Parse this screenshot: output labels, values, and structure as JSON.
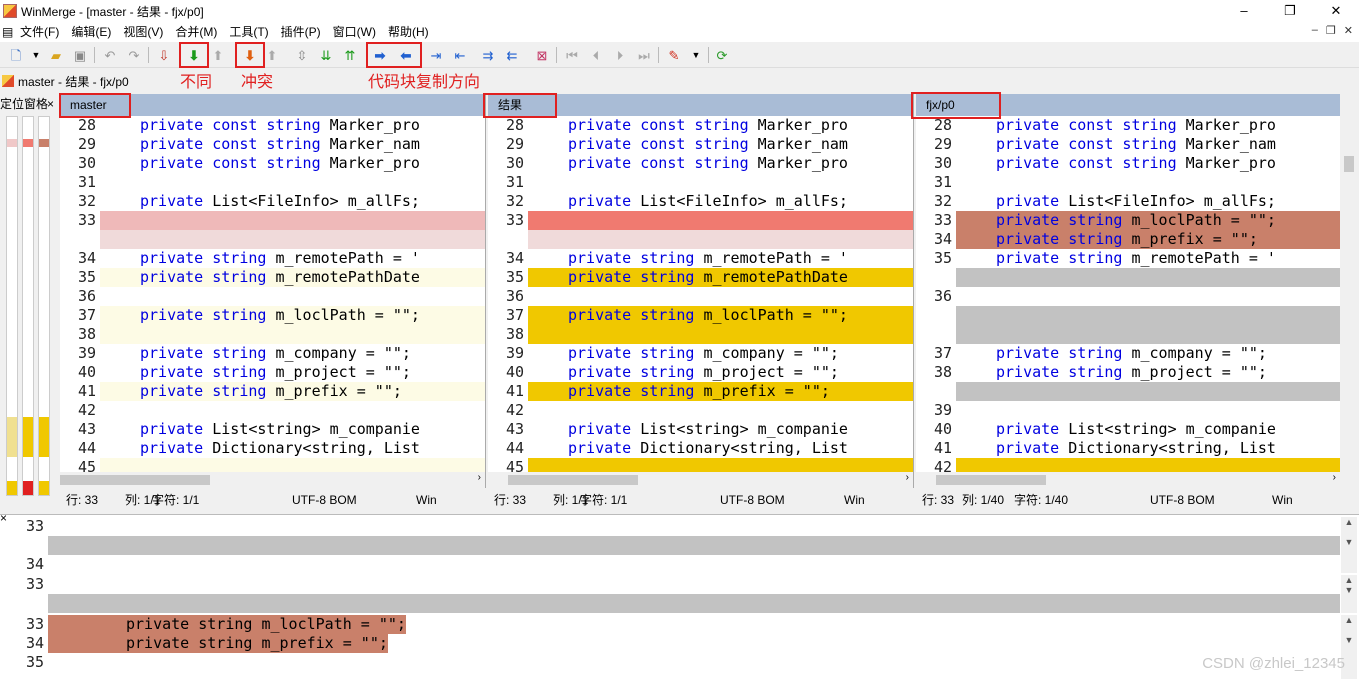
{
  "window": {
    "title": "WinMerge - [master - 结果 - fjx/p0]",
    "controls": [
      "–",
      "❐",
      "✕"
    ]
  },
  "menu": {
    "items": [
      "文件(F)",
      "编辑(E)",
      "视图(V)",
      "合并(M)",
      "工具(T)",
      "插件(P)",
      "窗口(W)",
      "帮助(H)"
    ],
    "mdi_controls": [
      "–",
      "❐",
      "✕"
    ]
  },
  "annotations": {
    "diff": "不同",
    "conflict": "冲突",
    "direction": "代码块复制方向"
  },
  "tab": {
    "label": "master - 结果 - fjx/p0"
  },
  "location_pane": {
    "title": "定位窗格",
    "close": "×"
  },
  "panes": [
    {
      "header": "master",
      "lines": [
        {
          "n": "28",
          "kw": "private const string",
          "rest": " Marker_pro",
          "bg": ""
        },
        {
          "n": "29",
          "kw": "private const string",
          "rest": " Marker_nam",
          "bg": ""
        },
        {
          "n": "30",
          "kw": "private const string",
          "rest": " Marker_pro",
          "bg": ""
        },
        {
          "n": "31",
          "kw": "",
          "rest": "",
          "bg": ""
        },
        {
          "n": "32",
          "kw": "private",
          "rest": " List<FileInfo> m_allFs;",
          "bg": ""
        },
        {
          "n": "33",
          "kw": "",
          "rest": "",
          "bg": "diff-del"
        },
        {
          "n": "",
          "kw": "",
          "rest": "",
          "bg": "diff-del2"
        },
        {
          "n": "34",
          "kw": "private string",
          "rest": " m_remotePath = '",
          "bg": ""
        },
        {
          "n": "35",
          "kw": "private string",
          "rest": " m_remotePathDate",
          "bg": "diff-chg"
        },
        {
          "n": "36",
          "kw": "",
          "rest": "",
          "bg": ""
        },
        {
          "n": "37",
          "kw": "private string",
          "rest": " m_loclPath = \"\";",
          "bg": "diff-chg"
        },
        {
          "n": "38",
          "kw": "",
          "rest": "",
          "bg": "diff-chg"
        },
        {
          "n": "39",
          "kw": "private string",
          "rest": " m_company = \"\";",
          "bg": ""
        },
        {
          "n": "40",
          "kw": "private string",
          "rest": " m_project = \"\";",
          "bg": ""
        },
        {
          "n": "41",
          "kw": "private string",
          "rest": " m_prefix = \"\";",
          "bg": "diff-chg"
        },
        {
          "n": "42",
          "kw": "",
          "rest": "",
          "bg": ""
        },
        {
          "n": "43",
          "kw": "private",
          "rest": " List<string> m_companie",
          "kw2": "string",
          "bg": ""
        },
        {
          "n": "44",
          "kw": "private",
          "rest": " Dictionary<string, List",
          "bg": ""
        },
        {
          "n": "45",
          "kw": "",
          "rest": "",
          "bg": "diff-chg"
        }
      ],
      "status": {
        "pos": "行: 33",
        "col": "列: 1/1",
        "chr": "字符: 1/1",
        "enc": "UTF-8 BOM",
        "eol": "Win"
      }
    },
    {
      "header": "结果",
      "lines": [
        {
          "n": "28",
          "kw": "private const string",
          "rest": " Marker_pro",
          "bg": ""
        },
        {
          "n": "29",
          "kw": "private const string",
          "rest": " Marker_nam",
          "bg": ""
        },
        {
          "n": "30",
          "kw": "private const string",
          "rest": " Marker_pro",
          "bg": ""
        },
        {
          "n": "31",
          "kw": "",
          "rest": "",
          "bg": ""
        },
        {
          "n": "32",
          "kw": "private",
          "rest": " List<FileInfo> m_allFs;",
          "bg": ""
        },
        {
          "n": "33",
          "kw": "",
          "rest": "",
          "bg": "diff-red"
        },
        {
          "n": "",
          "kw": "",
          "rest": "",
          "bg": "diff-del2"
        },
        {
          "n": "34",
          "kw": "private string",
          "rest": " m_remotePath = '",
          "bg": ""
        },
        {
          "n": "35",
          "kw": "private string",
          "rest": " m_remotePathDate",
          "bg": "diff-yel"
        },
        {
          "n": "36",
          "kw": "",
          "rest": "",
          "bg": ""
        },
        {
          "n": "37",
          "kw": "private string",
          "rest": " m_loclPath = \"\";",
          "bg": "diff-yel"
        },
        {
          "n": "38",
          "kw": "",
          "rest": "",
          "bg": "diff-yel"
        },
        {
          "n": "39",
          "kw": "private string",
          "rest": " m_company = \"\";",
          "bg": ""
        },
        {
          "n": "40",
          "kw": "private string",
          "rest": " m_project = \"\";",
          "bg": ""
        },
        {
          "n": "41",
          "kw": "private string",
          "rest": " m_prefix = \"\";",
          "bg": "diff-yel"
        },
        {
          "n": "42",
          "kw": "",
          "rest": "",
          "bg": ""
        },
        {
          "n": "43",
          "kw": "private",
          "rest": " List<string> m_companie",
          "bg": ""
        },
        {
          "n": "44",
          "kw": "private",
          "rest": " Dictionary<string, List",
          "bg": ""
        },
        {
          "n": "45",
          "kw": "",
          "rest": "",
          "bg": "diff-yel"
        }
      ],
      "status": {
        "pos": "行: 33",
        "col": "列: 1/1",
        "chr": "字符: 1/1",
        "enc": "UTF-8 BOM",
        "eol": "Win"
      }
    },
    {
      "header": "fjx/p0",
      "lines": [
        {
          "n": "28",
          "kw": "private const string",
          "rest": " Marker_pro",
          "bg": ""
        },
        {
          "n": "29",
          "kw": "private const string",
          "rest": " Marker_nam",
          "bg": ""
        },
        {
          "n": "30",
          "kw": "private const string",
          "rest": " Marker_pro",
          "bg": ""
        },
        {
          "n": "31",
          "kw": "",
          "rest": "",
          "bg": ""
        },
        {
          "n": "32",
          "kw": "private",
          "rest": " List<FileInfo> m_allFs;",
          "bg": ""
        },
        {
          "n": "33",
          "kw": "private string",
          "rest": " m_loclPath = \"\";",
          "bg": "diff-brn"
        },
        {
          "n": "34",
          "kw": "private string",
          "rest": " m_prefix = \"\";",
          "bg": "diff-brn"
        },
        {
          "n": "35",
          "kw": "private string",
          "rest": " m_remotePath = '",
          "bg": ""
        },
        {
          "n": "",
          "kw": "",
          "rest": "",
          "bg": "diff-gry"
        },
        {
          "n": "36",
          "kw": "",
          "rest": "",
          "bg": ""
        },
        {
          "n": "",
          "kw": "",
          "rest": "",
          "bg": "diff-gry"
        },
        {
          "n": "",
          "kw": "",
          "rest": "",
          "bg": "diff-gry"
        },
        {
          "n": "37",
          "kw": "private string",
          "rest": " m_company = \"\";",
          "bg": ""
        },
        {
          "n": "38",
          "kw": "private string",
          "rest": " m_project = \"\";",
          "bg": ""
        },
        {
          "n": "",
          "kw": "",
          "rest": "",
          "bg": "diff-gry"
        },
        {
          "n": "39",
          "kw": "",
          "rest": "",
          "bg": ""
        },
        {
          "n": "40",
          "kw": "private",
          "rest": " List<string> m_companie",
          "bg": ""
        },
        {
          "n": "41",
          "kw": "private",
          "rest": " Dictionary<string, List",
          "bg": ""
        },
        {
          "n": "42",
          "kw": "",
          "rest": "",
          "bg": "diff-yel"
        }
      ],
      "status": {
        "pos": "行: 33",
        "col": "列: 1/40",
        "chr": "字符: 1/40",
        "enc": "UTF-8 BOM",
        "eol": "Win"
      }
    }
  ],
  "detail": {
    "blocks": [
      {
        "lines": [
          {
            "n": "33",
            "text": "",
            "bg": ""
          },
          {
            "n": "",
            "text": "",
            "bg": "diff-gry"
          },
          {
            "n": "34",
            "text": "",
            "bg": ""
          }
        ]
      },
      {
        "lines": [
          {
            "n": "33",
            "text": "",
            "bg": ""
          },
          {
            "n": "",
            "text": "",
            "bg": "diff-gry"
          }
        ]
      },
      {
        "lines": [
          {
            "n": "33",
            "text": "private string m_loclPath = \"\";",
            "bg": "diff-brn"
          },
          {
            "n": "34",
            "text": "private string m_prefix = \"\";",
            "bg": "diff-brn"
          },
          {
            "n": "35",
            "text": "",
            "bg": ""
          }
        ]
      }
    ]
  },
  "watermark": "CSDN @zhlei_12345",
  "colors": {
    "header_bg": "#a9bcd6",
    "diff_yellow": "#f0c800",
    "diff_red": "#f07a70",
    "diff_brown": "#c9806a",
    "diff_gray": "#c2c2c2",
    "annotation_red": "#e02020",
    "keyword_blue": "#0000e0"
  }
}
